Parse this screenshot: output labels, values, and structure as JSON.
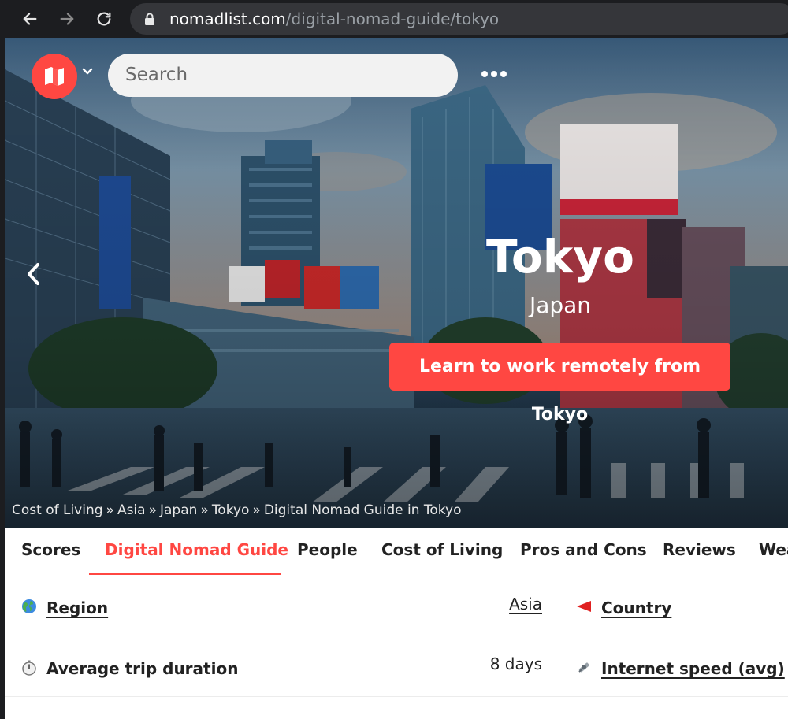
{
  "browser": {
    "url_host": "nomadlist.com",
    "url_path": "/digital-nomad-guide/tokyo"
  },
  "header": {
    "search_placeholder": "Search"
  },
  "hero": {
    "city": "Tokyo",
    "country": "Japan",
    "cta_label": "Learn to work remotely from Tokyo"
  },
  "breadcrumb": {
    "items": [
      "Cost of Living",
      "Asia",
      "Japan",
      "Tokyo",
      "Digital Nomad Guide in Tokyo"
    ],
    "separator": "»"
  },
  "tabs": [
    {
      "label": "Scores"
    },
    {
      "label": "Digital Nomad Guide"
    },
    {
      "label": "People"
    },
    {
      "label": "Cost of Living"
    },
    {
      "label": "Pros and Cons"
    },
    {
      "label": "Reviews"
    },
    {
      "label": "Wea"
    }
  ],
  "active_tab": "Digital Nomad Guide",
  "rows": [
    {
      "icon": "globe-icon",
      "label": "Region",
      "value": "Asia",
      "right_icon": "flag-icon",
      "right_label": "Country"
    },
    {
      "icon": "stopwatch-icon",
      "label": "Average trip duration",
      "value": "8 days",
      "right_icon": "satellite-icon",
      "right_label": "Internet speed (avg)"
    }
  ],
  "colors": {
    "accent": "#ff4742",
    "chrome": "#1c1d20",
    "url_bar": "#35363a"
  }
}
